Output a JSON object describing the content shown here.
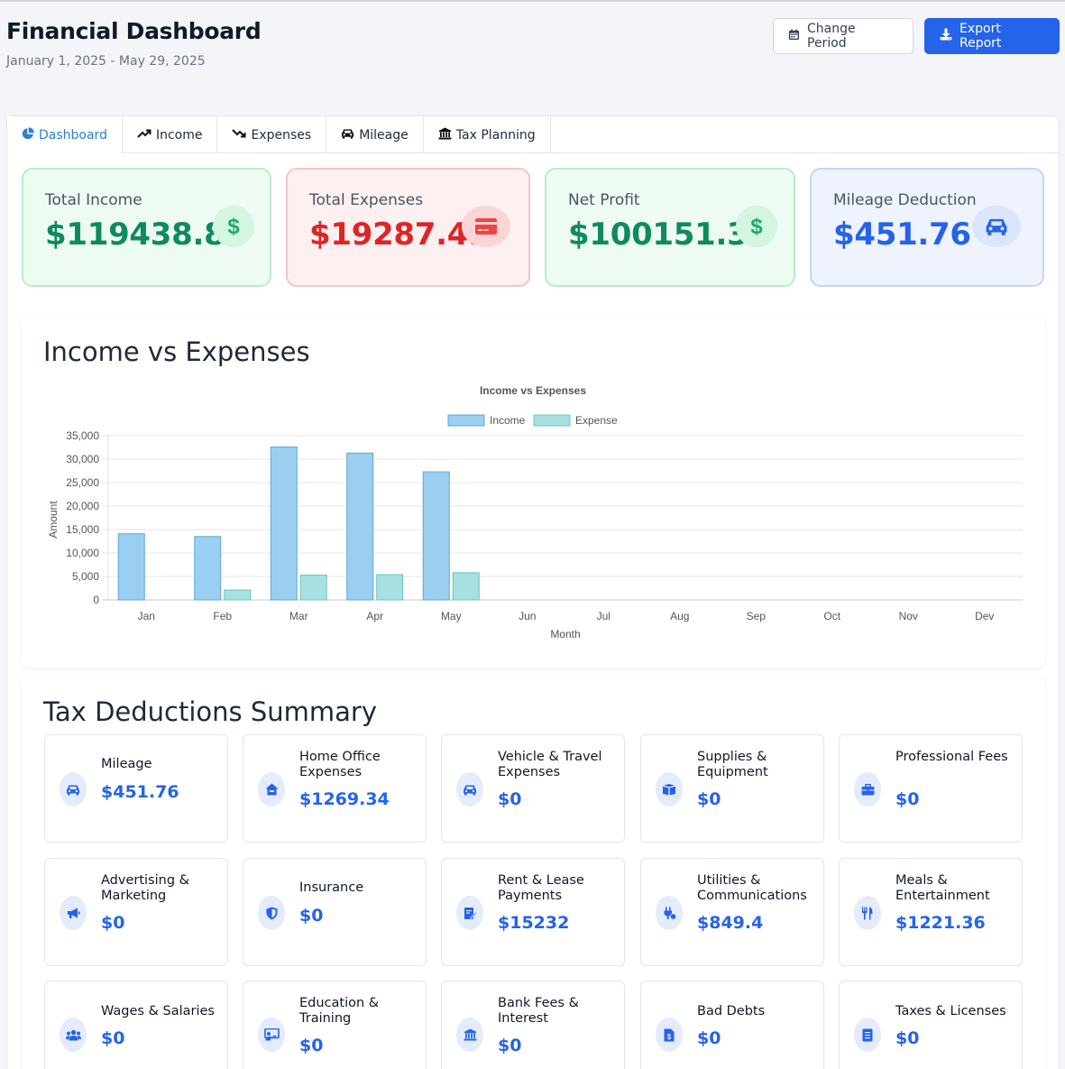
{
  "header": {
    "title": "Financial Dashboard",
    "date_range": "January 1, 2025 - May 29, 2025",
    "change_period_label": "Change Period",
    "export_label": "Export Report"
  },
  "tabs": [
    {
      "label": "Dashboard",
      "icon": "pie-chart-icon"
    },
    {
      "label": "Income",
      "icon": "trend-up-icon"
    },
    {
      "label": "Expenses",
      "icon": "trend-down-icon"
    },
    {
      "label": "Mileage",
      "icon": "car-icon"
    },
    {
      "label": "Tax Planning",
      "icon": "bank-icon"
    }
  ],
  "stats": {
    "income": {
      "label": "Total Income",
      "value": "$119438.86",
      "color": "#0f8a5f"
    },
    "expenses": {
      "label": "Total Expenses",
      "value": "$19287.49",
      "color": "#dc2626"
    },
    "net": {
      "label": "Net Profit",
      "value": "$100151.37",
      "color": "#0f8a5f"
    },
    "mileage": {
      "label": "Mileage Deduction",
      "value": "$451.76",
      "color": "#2563eb"
    }
  },
  "chart_section": {
    "heading": "Income vs Expenses"
  },
  "chart_data": {
    "type": "bar",
    "title": "Income vs Expenses",
    "xlabel": "Month",
    "ylabel": "Amount",
    "categories": [
      "Jan",
      "Feb",
      "Mar",
      "Apr",
      "May",
      "Jun",
      "Jul",
      "Aug",
      "Sep",
      "Oct",
      "Nov",
      "Dev"
    ],
    "series": [
      {
        "name": "Income",
        "values": [
          14100,
          13500,
          32600,
          31300,
          27300,
          0,
          0,
          0,
          0,
          0,
          0,
          0
        ],
        "color": "#9acff2"
      },
      {
        "name": "Expense",
        "values": [
          0,
          2100,
          5300,
          5400,
          5800,
          0,
          0,
          0,
          0,
          0,
          0,
          0
        ],
        "color": "#a6e0e0"
      }
    ],
    "ylim": [
      0,
      35000
    ],
    "yticks": [
      "0",
      "5,000",
      "10,000",
      "15,000",
      "20,000",
      "25,000",
      "30,000",
      "35,000"
    ],
    "legend": "top",
    "grid": true
  },
  "deductions": {
    "heading": "Tax Deductions Summary",
    "items": [
      {
        "name": "Mileage",
        "value": "$451.76",
        "icon": "car-icon"
      },
      {
        "name": "Home Office Expenses",
        "value": "$1269.34",
        "icon": "house-icon"
      },
      {
        "name": "Vehicle & Travel Expenses",
        "value": "$0",
        "icon": "car-icon"
      },
      {
        "name": "Supplies & Equipment",
        "value": "$0",
        "icon": "box-icon"
      },
      {
        "name": "Professional Fees",
        "value": "$0",
        "icon": "briefcase-icon"
      },
      {
        "name": "Advertising & Marketing",
        "value": "$0",
        "icon": "megaphone-icon"
      },
      {
        "name": "Insurance",
        "value": "$0",
        "icon": "shield-icon"
      },
      {
        "name": "Rent & Lease Payments",
        "value": "$15232",
        "icon": "contract-icon"
      },
      {
        "name": "Utilities & Communications",
        "value": "$849.4",
        "icon": "plug-icon"
      },
      {
        "name": "Meals & Entertainment",
        "value": "$1221.36",
        "icon": "utensils-icon"
      },
      {
        "name": "Wages & Salaries",
        "value": "$0",
        "icon": "users-icon"
      },
      {
        "name": "Education & Training",
        "value": "$0",
        "icon": "chalkboard-icon"
      },
      {
        "name": "Bank Fees & Interest",
        "value": "$0",
        "icon": "bank-icon"
      },
      {
        "name": "Bad Debts",
        "value": "$0",
        "icon": "invoice-icon"
      },
      {
        "name": "Taxes & Licenses",
        "value": "$0",
        "icon": "document-icon"
      }
    ]
  }
}
